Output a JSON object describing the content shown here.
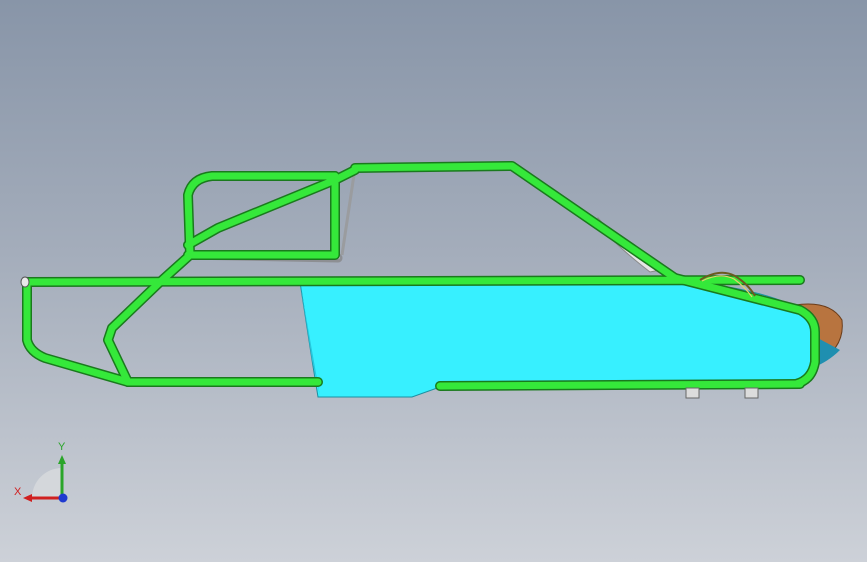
{
  "viewport": {
    "background_top": "#8895a8",
    "background_bottom": "#cdd1d8"
  },
  "model": {
    "frame_color": "#35e83a",
    "frame_outline": "#1a7a1d",
    "panel_color": "#37f0ff",
    "panel_shade": "#27c7dd",
    "bar_color": "#b7b9bd",
    "nose_color": "#b8743f"
  },
  "triad": {
    "y_label": "Y",
    "x_label": "X",
    "y_color": "#2aa52a",
    "x_color": "#d02020",
    "z_color": "#1f3ad0"
  }
}
